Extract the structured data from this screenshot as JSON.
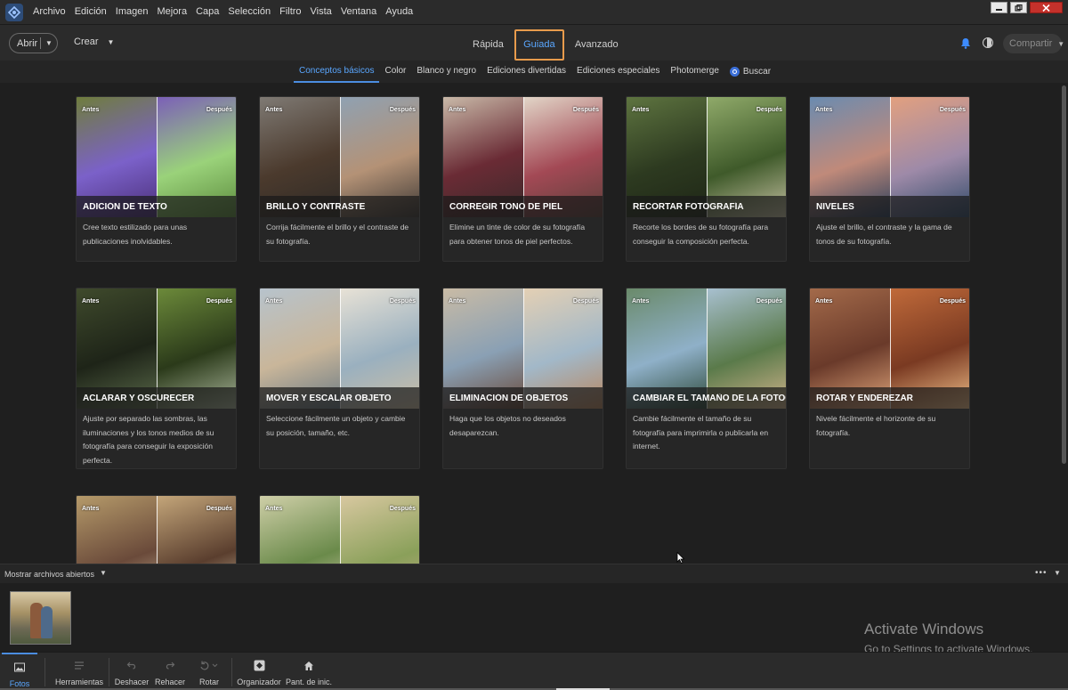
{
  "menubar": {
    "items": [
      "Archivo",
      "Edición",
      "Imagen",
      "Mejora",
      "Capa",
      "Selección",
      "Filtro",
      "Vista",
      "Ventana",
      "Ayuda"
    ]
  },
  "toolbar": {
    "open_label": "Abrir",
    "create_label": "Crear",
    "modes": [
      "Rápida",
      "Guiada",
      "Avanzado"
    ],
    "active_mode": "Guiada",
    "share_label": "Compartir"
  },
  "category_tabs": {
    "items": [
      "Conceptos básicos",
      "Color",
      "Blanco y negro",
      "Ediciones divertidas",
      "Ediciones especiales",
      "Photomerge"
    ],
    "active": "Conceptos básicos",
    "search_label": "Buscar"
  },
  "cards": {
    "before_label": "Antes",
    "after_label": "Después",
    "items": [
      {
        "title": "ADICIÓN DE TEXTO",
        "description": "Cree texto estilizado para unas publicaciones inolvidables."
      },
      {
        "title": "BRILLO Y CONTRASTE",
        "description": "Corrija fácilmente el brillo y el contraste de su fotografía."
      },
      {
        "title": "CORREGIR TONO DE PIEL",
        "description": "Elimine un tinte de color de su fotografía para obtener tonos de piel perfectos."
      },
      {
        "title": "RECORTAR FOTOGRAFÍA",
        "description": "Recorte los bordes de su fotografía para conseguir la composición perfecta."
      },
      {
        "title": "NIVELES",
        "description": "Ajuste el brillo, el contraste y la gama de tonos de su fotografía."
      },
      {
        "title": "ACLARAR Y OSCURECER",
        "description": "Ajuste por separado las sombras, las iluminaciones y los tonos medios de su fotografía para conseguir la exposición perfecta."
      },
      {
        "title": "MOVER Y ESCALAR OBJETO",
        "description": "Seleccione fácilmente un objeto y cambie su posición, tamaño, etc."
      },
      {
        "title": "ELIMINACIÓN DE OBJETOS",
        "description": "Haga que los objetos no deseados desaparezcan."
      },
      {
        "title": "CAMBIAR EL TAMAÑO DE LA FOTOGR...",
        "description": "Cambie fácilmente el tamaño de su fotografía para imprimirla o publicarla en internet."
      },
      {
        "title": "ROTAR Y ENDEREZAR",
        "description": "Nivele fácilmente el horizonte de su fotografía."
      },
      {
        "title": "",
        "description": ""
      },
      {
        "title": "",
        "description": ""
      }
    ],
    "palettes": [
      [
        "#6f7d3c",
        "#7b61c9",
        "#4a2f78",
        "#7b5fb8",
        "#9ad27a",
        "#5b8a3c"
      ],
      [
        "#7f7a74",
        "#4b3a2d",
        "#2e2a26",
        "#8fa1b2",
        "#b49276",
        "#3c3835"
      ],
      [
        "#c9b9a8",
        "#6a2b35",
        "#3a2a2a",
        "#e2d6c8",
        "#a34955",
        "#5a3f3a"
      ],
      [
        "#5e7440",
        "#2d3a20",
        "#1e2616",
        "#90aa6a",
        "#3f5a2a",
        "#c6c1a3"
      ],
      [
        "#6a8bb0",
        "#c08a7a",
        "#2b3f5c",
        "#e2a07f",
        "#9e8aa8",
        "#2f4a68"
      ],
      [
        "#3f4a2c",
        "#1e2418",
        "#5a6a4a",
        "#6c8a3a",
        "#2b3a1a",
        "#a9b59a"
      ],
      [
        "#b7c3cc",
        "#c9b69a",
        "#6a7a84",
        "#e8e2d6",
        "#9ab0bf",
        "#cdbfa5"
      ],
      [
        "#c9bba5",
        "#8aa0b4",
        "#6a4a3a",
        "#e4d0b4",
        "#a2b8c8",
        "#b9865e"
      ],
      [
        "#6a8a6a",
        "#8fb0c8",
        "#2e4a3a",
        "#a8c0d0",
        "#5a7a4a",
        "#d2b48c"
      ],
      [
        "#a36a4a",
        "#6a3a2a",
        "#e0a57a",
        "#c06a3a",
        "#7a3a22",
        "#f0c08a"
      ],
      [
        "#b59a6a",
        "#6a4a3a",
        "#d8c8a8",
        "#c4a67a",
        "#5a3e2e",
        "#efe0c0"
      ],
      [
        "#cfcfa8",
        "#6a8a4a",
        "#e8d8c0",
        "#d8c8a0",
        "#8aa05a",
        "#c8a88a"
      ]
    ]
  },
  "bin": {
    "label": "Mostrar archivos abiertos",
    "more": "•••"
  },
  "watermark": {
    "title": "Activate Windows",
    "subtitle": "Go to Settings to activate Windows."
  },
  "bottombar": {
    "buttons": [
      {
        "label": "Fotos",
        "icon": "photos-icon"
      },
      {
        "label": "Herramientas",
        "icon": "tools-icon"
      },
      {
        "label": "Deshacer",
        "icon": "undo-icon"
      },
      {
        "label": "Rehacer",
        "icon": "redo-icon"
      },
      {
        "label": "Rotar",
        "icon": "rotate-icon"
      },
      {
        "label": "Organizador",
        "icon": "organizer-icon"
      },
      {
        "label": "Pant. de inic.",
        "icon": "home-icon"
      }
    ]
  },
  "colors": {
    "accent": "#5aa7ff",
    "active_tab_outline": "#e89b4c",
    "background": "#1f1f1f"
  }
}
